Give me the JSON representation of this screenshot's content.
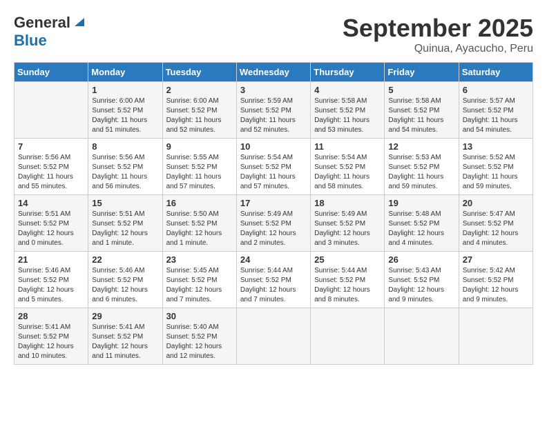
{
  "header": {
    "logo_general": "General",
    "logo_blue": "Blue",
    "month": "September 2025",
    "location": "Quinua, Ayacucho, Peru"
  },
  "weekdays": [
    "Sunday",
    "Monday",
    "Tuesday",
    "Wednesday",
    "Thursday",
    "Friday",
    "Saturday"
  ],
  "weeks": [
    [
      {
        "day": "",
        "info": ""
      },
      {
        "day": "1",
        "info": "Sunrise: 6:00 AM\nSunset: 5:52 PM\nDaylight: 11 hours\nand 51 minutes."
      },
      {
        "day": "2",
        "info": "Sunrise: 6:00 AM\nSunset: 5:52 PM\nDaylight: 11 hours\nand 52 minutes."
      },
      {
        "day": "3",
        "info": "Sunrise: 5:59 AM\nSunset: 5:52 PM\nDaylight: 11 hours\nand 52 minutes."
      },
      {
        "day": "4",
        "info": "Sunrise: 5:58 AM\nSunset: 5:52 PM\nDaylight: 11 hours\nand 53 minutes."
      },
      {
        "day": "5",
        "info": "Sunrise: 5:58 AM\nSunset: 5:52 PM\nDaylight: 11 hours\nand 54 minutes."
      },
      {
        "day": "6",
        "info": "Sunrise: 5:57 AM\nSunset: 5:52 PM\nDaylight: 11 hours\nand 54 minutes."
      }
    ],
    [
      {
        "day": "7",
        "info": "Sunrise: 5:56 AM\nSunset: 5:52 PM\nDaylight: 11 hours\nand 55 minutes."
      },
      {
        "day": "8",
        "info": "Sunrise: 5:56 AM\nSunset: 5:52 PM\nDaylight: 11 hours\nand 56 minutes."
      },
      {
        "day": "9",
        "info": "Sunrise: 5:55 AM\nSunset: 5:52 PM\nDaylight: 11 hours\nand 57 minutes."
      },
      {
        "day": "10",
        "info": "Sunrise: 5:54 AM\nSunset: 5:52 PM\nDaylight: 11 hours\nand 57 minutes."
      },
      {
        "day": "11",
        "info": "Sunrise: 5:54 AM\nSunset: 5:52 PM\nDaylight: 11 hours\nand 58 minutes."
      },
      {
        "day": "12",
        "info": "Sunrise: 5:53 AM\nSunset: 5:52 PM\nDaylight: 11 hours\nand 59 minutes."
      },
      {
        "day": "13",
        "info": "Sunrise: 5:52 AM\nSunset: 5:52 PM\nDaylight: 11 hours\nand 59 minutes."
      }
    ],
    [
      {
        "day": "14",
        "info": "Sunrise: 5:51 AM\nSunset: 5:52 PM\nDaylight: 12 hours\nand 0 minutes."
      },
      {
        "day": "15",
        "info": "Sunrise: 5:51 AM\nSunset: 5:52 PM\nDaylight: 12 hours\nand 1 minute."
      },
      {
        "day": "16",
        "info": "Sunrise: 5:50 AM\nSunset: 5:52 PM\nDaylight: 12 hours\nand 1 minute."
      },
      {
        "day": "17",
        "info": "Sunrise: 5:49 AM\nSunset: 5:52 PM\nDaylight: 12 hours\nand 2 minutes."
      },
      {
        "day": "18",
        "info": "Sunrise: 5:49 AM\nSunset: 5:52 PM\nDaylight: 12 hours\nand 3 minutes."
      },
      {
        "day": "19",
        "info": "Sunrise: 5:48 AM\nSunset: 5:52 PM\nDaylight: 12 hours\nand 4 minutes."
      },
      {
        "day": "20",
        "info": "Sunrise: 5:47 AM\nSunset: 5:52 PM\nDaylight: 12 hours\nand 4 minutes."
      }
    ],
    [
      {
        "day": "21",
        "info": "Sunrise: 5:46 AM\nSunset: 5:52 PM\nDaylight: 12 hours\nand 5 minutes."
      },
      {
        "day": "22",
        "info": "Sunrise: 5:46 AM\nSunset: 5:52 PM\nDaylight: 12 hours\nand 6 minutes."
      },
      {
        "day": "23",
        "info": "Sunrise: 5:45 AM\nSunset: 5:52 PM\nDaylight: 12 hours\nand 7 minutes."
      },
      {
        "day": "24",
        "info": "Sunrise: 5:44 AM\nSunset: 5:52 PM\nDaylight: 12 hours\nand 7 minutes."
      },
      {
        "day": "25",
        "info": "Sunrise: 5:44 AM\nSunset: 5:52 PM\nDaylight: 12 hours\nand 8 minutes."
      },
      {
        "day": "26",
        "info": "Sunrise: 5:43 AM\nSunset: 5:52 PM\nDaylight: 12 hours\nand 9 minutes."
      },
      {
        "day": "27",
        "info": "Sunrise: 5:42 AM\nSunset: 5:52 PM\nDaylight: 12 hours\nand 9 minutes."
      }
    ],
    [
      {
        "day": "28",
        "info": "Sunrise: 5:41 AM\nSunset: 5:52 PM\nDaylight: 12 hours\nand 10 minutes."
      },
      {
        "day": "29",
        "info": "Sunrise: 5:41 AM\nSunset: 5:52 PM\nDaylight: 12 hours\nand 11 minutes."
      },
      {
        "day": "30",
        "info": "Sunrise: 5:40 AM\nSunset: 5:52 PM\nDaylight: 12 hours\nand 12 minutes."
      },
      {
        "day": "",
        "info": ""
      },
      {
        "day": "",
        "info": ""
      },
      {
        "day": "",
        "info": ""
      },
      {
        "day": "",
        "info": ""
      }
    ]
  ]
}
